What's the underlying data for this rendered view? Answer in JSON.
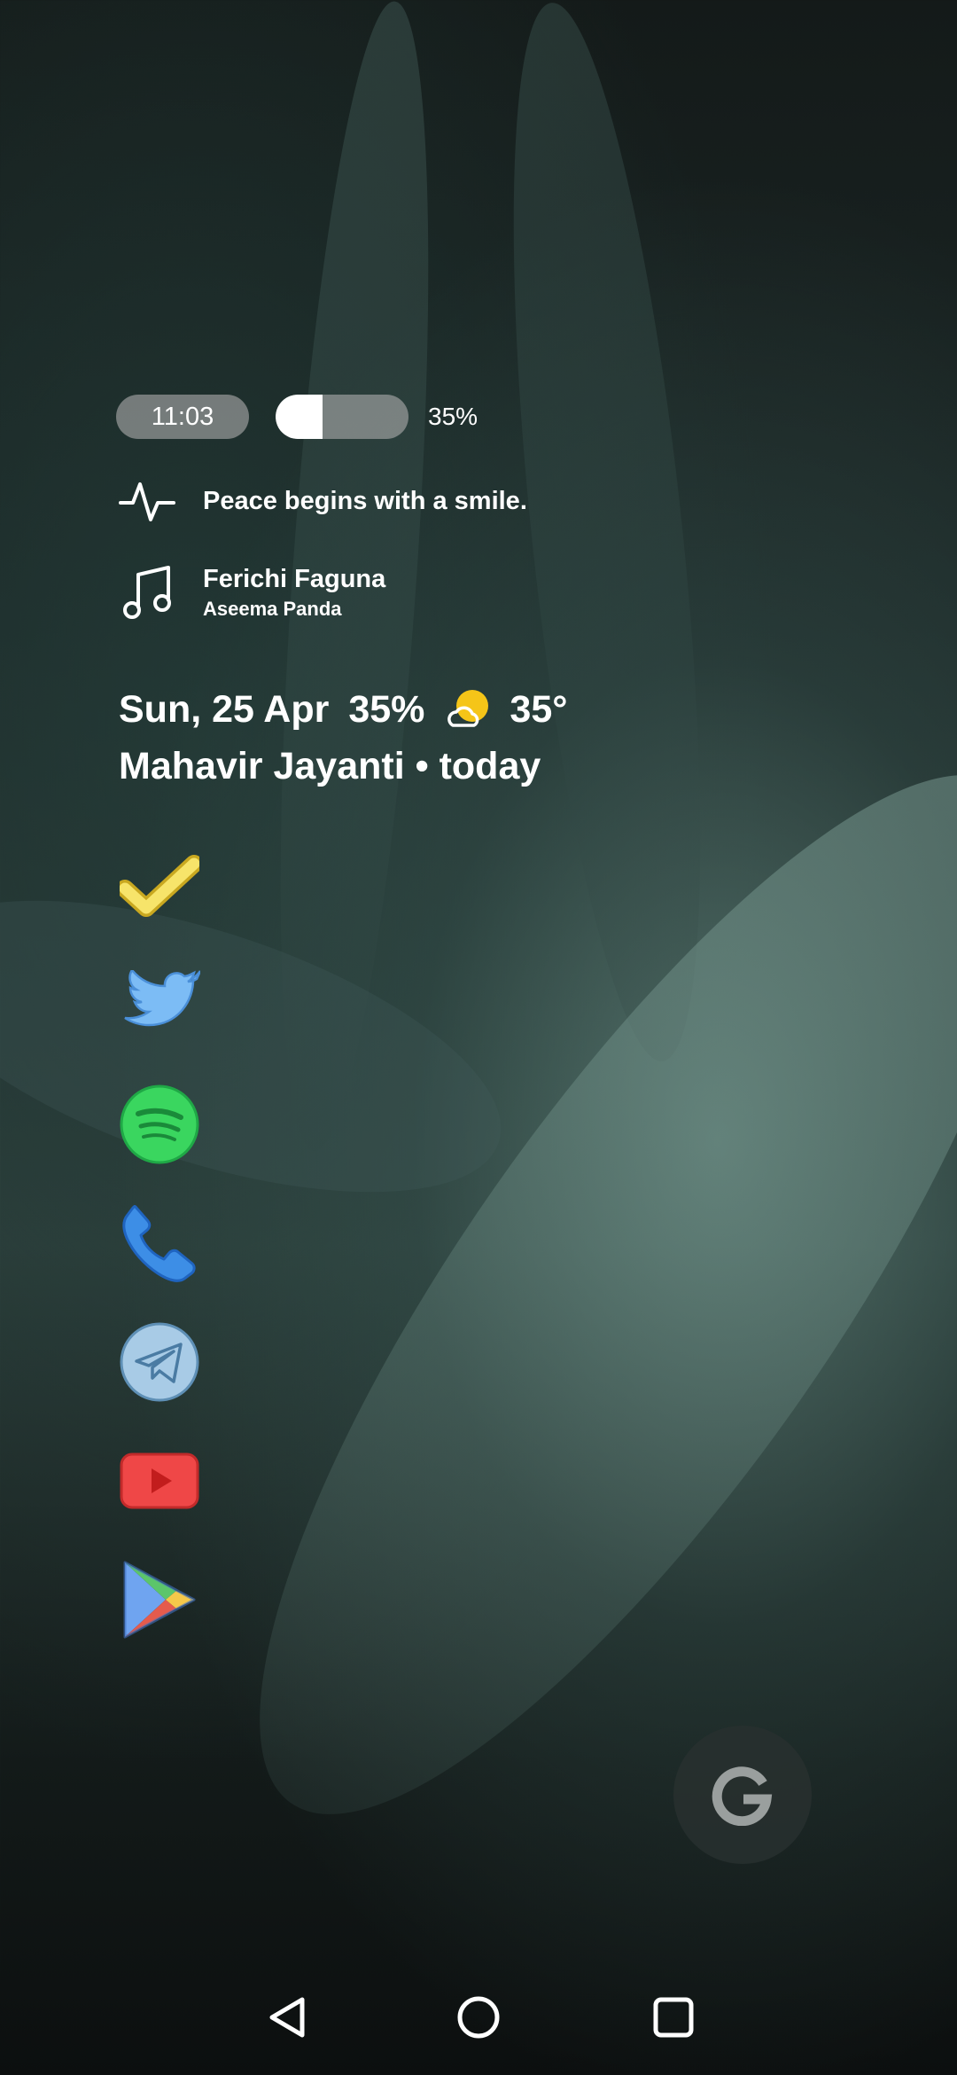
{
  "status": {
    "time": "11:03",
    "battery_text": "35%",
    "battery_level": 0.35
  },
  "quote": {
    "icon": "activity-pulse-icon",
    "text": "Peace begins with a smile."
  },
  "music": {
    "icon": "music-note-icon",
    "title": "Ferichi Faguna",
    "artist": "Aseema Panda"
  },
  "glance": {
    "date": "Sun, 25 Apr",
    "battery": "35%",
    "weather_icon": "partly-cloudy-icon",
    "temperature": "35°",
    "event": "Mahavir Jayanti • today"
  },
  "apps": [
    {
      "name": "tasks-check-icon",
      "color": "#f5d94a"
    },
    {
      "name": "twitter-icon",
      "color": "#6fb3f2"
    },
    {
      "name": "spotify-icon",
      "color": "#3ad65f"
    },
    {
      "name": "phone-icon",
      "color": "#3d8ee6"
    },
    {
      "name": "telegram-icon",
      "color": "#9cc3e0"
    },
    {
      "name": "youtube-icon",
      "color": "#ee4444"
    },
    {
      "name": "play-store-icon",
      "color": "#4caf50"
    }
  ],
  "search": {
    "icon": "google-g-icon",
    "letter": "G"
  },
  "navigation": {
    "back": "back-triangle-icon",
    "home": "home-circle-icon",
    "recents": "recents-square-icon"
  }
}
